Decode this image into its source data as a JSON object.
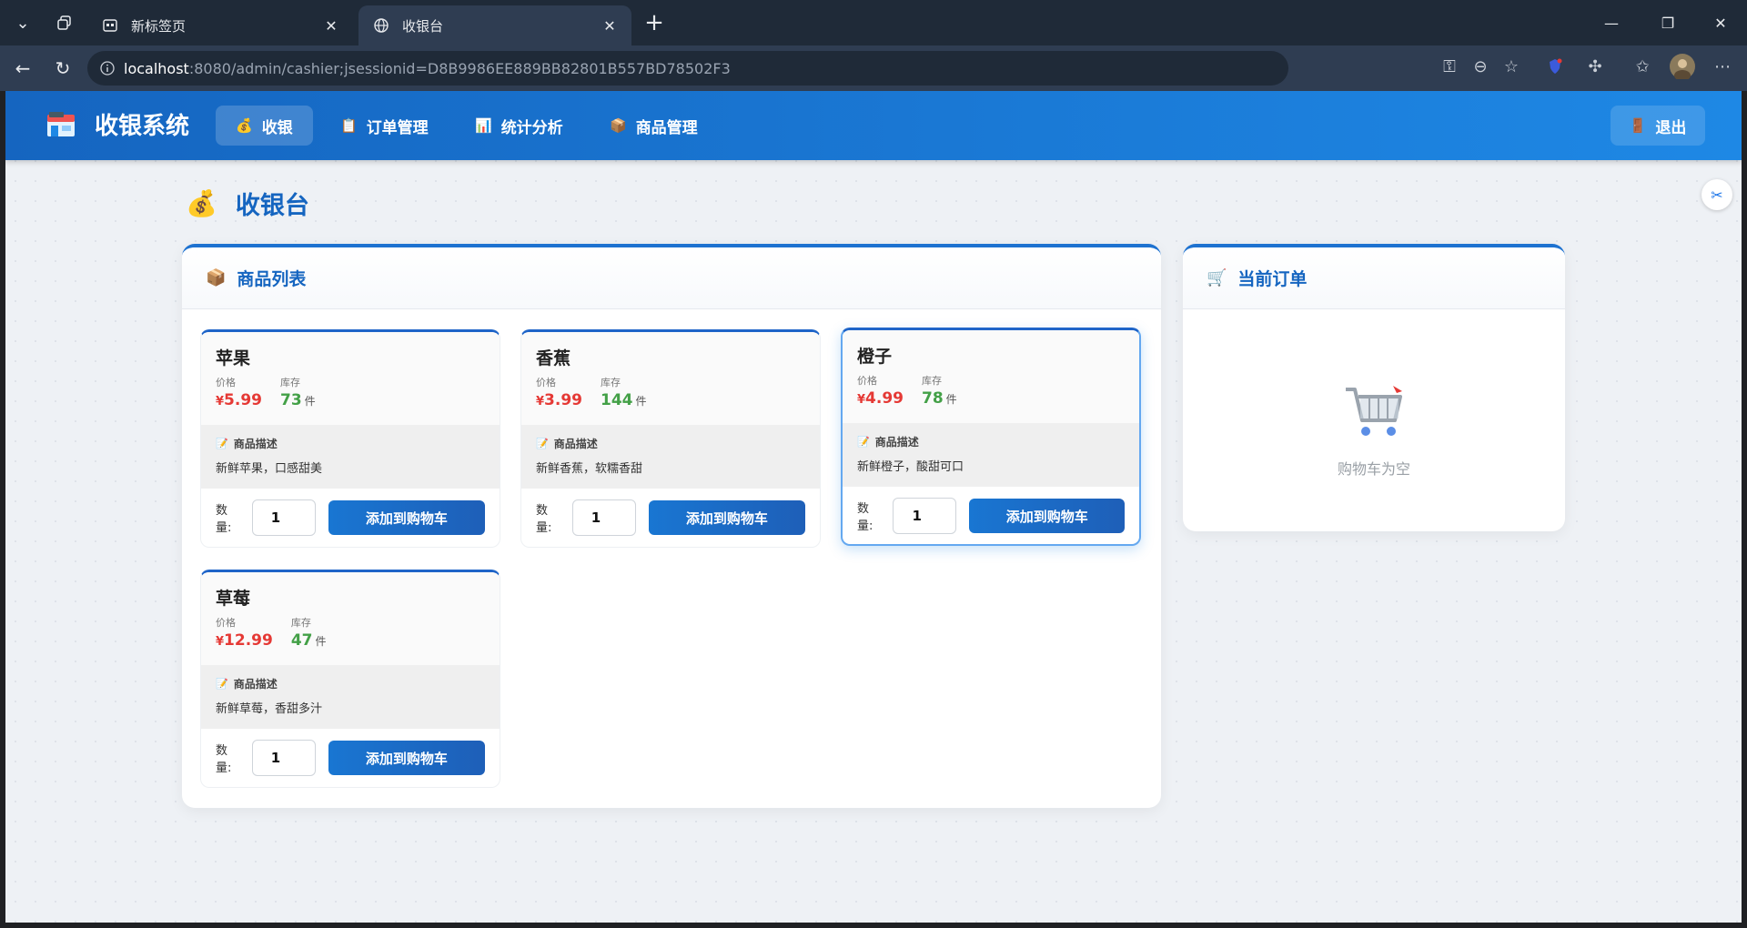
{
  "browser": {
    "tabs": [
      {
        "title": "新标签页",
        "active": false
      },
      {
        "title": "收银台",
        "active": true
      }
    ],
    "url_host": "localhost",
    "url_rest": ":8080/admin/cashier;jsessionid=D8B9986EE889BB82801B557BD78502F3"
  },
  "app": {
    "brand": "收银系统",
    "nav": [
      {
        "label": "收银",
        "icon": "money-bag-icon",
        "active": true
      },
      {
        "label": "订单管理",
        "icon": "clipboard-icon",
        "active": false
      },
      {
        "label": "统计分析",
        "icon": "bar-chart-icon",
        "active": false
      },
      {
        "label": "商品管理",
        "icon": "package-icon",
        "active": false
      }
    ],
    "logout": "退出"
  },
  "page": {
    "title": "收银台",
    "products_panel_title": "商品列表",
    "order_panel_title": "当前订单",
    "empty_cart": "购物车为空"
  },
  "labels": {
    "price": "价格",
    "stock": "库存",
    "unit": "件",
    "desc": "商品描述",
    "qty": "数量:",
    "add": "添加到购物车",
    "currency": "¥"
  },
  "products": [
    {
      "name": "苹果",
      "price": "5.99",
      "stock": "73",
      "desc": "新鲜苹果，口感甜美",
      "qty": "1"
    },
    {
      "name": "香蕉",
      "price": "3.99",
      "stock": "144",
      "desc": "新鲜香蕉，软糯香甜",
      "qty": "1"
    },
    {
      "name": "橙子",
      "price": "4.99",
      "stock": "78",
      "desc": "新鲜橙子，酸甜可口",
      "qty": "1"
    },
    {
      "name": "草莓",
      "price": "12.99",
      "stock": "47",
      "desc": "新鲜草莓，香甜多汁",
      "qty": "1"
    }
  ],
  "colors": {
    "accent": "#1565c0",
    "price": "#e53935",
    "stock": "#43a047"
  }
}
